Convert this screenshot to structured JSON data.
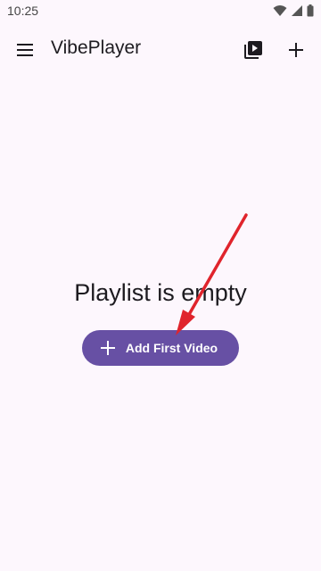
{
  "status_bar": {
    "time": "10:25",
    "icons": [
      "wifi-icon",
      "cellular-signal-icon",
      "battery-icon"
    ]
  },
  "app_bar": {
    "title": "VibePlayer",
    "icons": [
      "menu-icon",
      "video-library-icon",
      "add-icon"
    ]
  },
  "empty_state": {
    "message": "Playlist is empty",
    "button_label": "Add First Video"
  },
  "colors": {
    "background": "#fdf7fd",
    "primary": "#6750a4",
    "on_primary": "#ffffff",
    "text": "#1d1b20",
    "annotation_arrow": "#e0242c"
  }
}
